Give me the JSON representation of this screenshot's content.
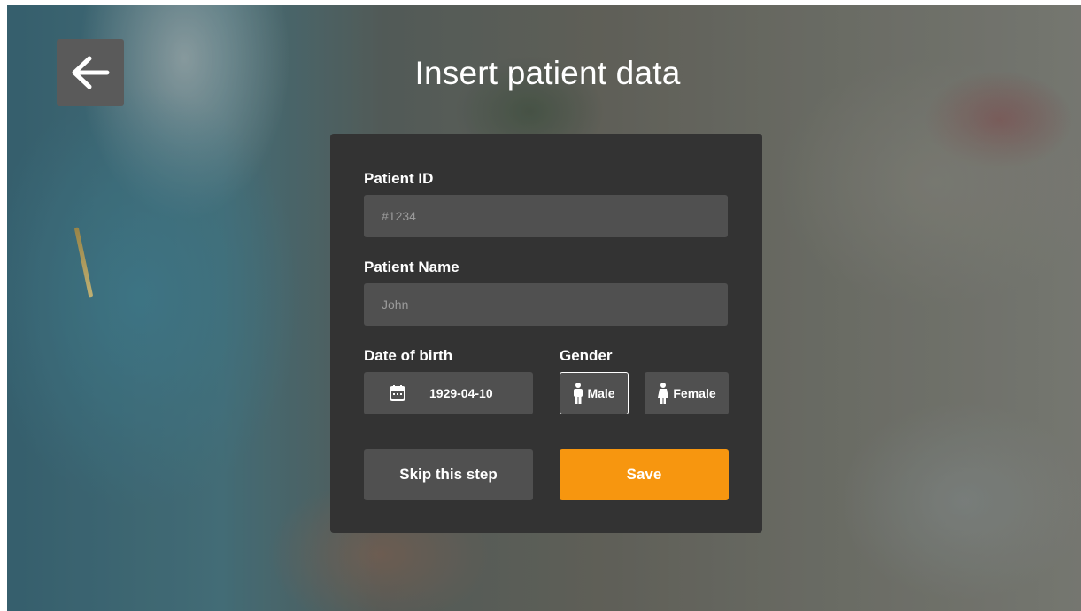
{
  "screen": {
    "title": "Insert patient data"
  },
  "form": {
    "patient_id": {
      "label": "Patient ID",
      "placeholder": "#1234",
      "value": ""
    },
    "patient_name": {
      "label": "Patient Name",
      "placeholder": "John",
      "value": ""
    },
    "date_of_birth": {
      "label": "Date of birth",
      "value": "1929-04-10"
    },
    "gender": {
      "label": "Gender",
      "options": [
        "Male",
        "Female"
      ],
      "selected": "Male"
    }
  },
  "actions": {
    "skip_label": "Skip this step",
    "save_label": "Save"
  },
  "icons": {
    "back": "arrow-left-icon",
    "calendar": "calendar-icon",
    "male": "male-figure-icon",
    "female": "female-figure-icon"
  },
  "colors": {
    "accent": "#f7960f",
    "panel": "#333333",
    "field": "#505050",
    "text": "#ffffff"
  }
}
